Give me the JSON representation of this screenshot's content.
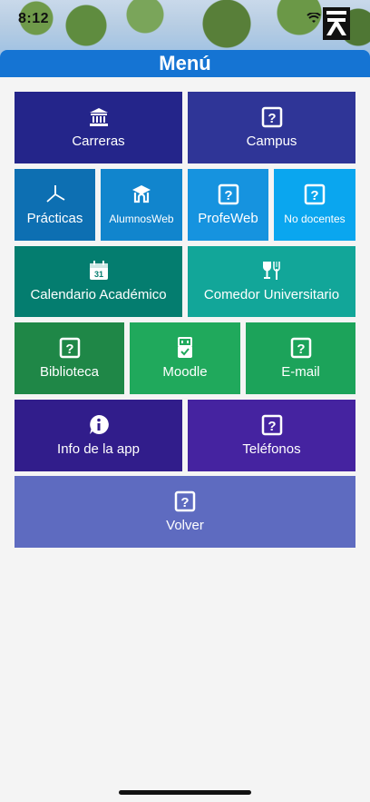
{
  "status": {
    "time": "8:12"
  },
  "header": {
    "title": "Menú"
  },
  "tiles": {
    "carreras": {
      "label": "Carreras",
      "color": "#24258a",
      "icon": "university-icon"
    },
    "campus": {
      "label": "Campus",
      "color": "#2f3597",
      "icon": "question-icon"
    },
    "practicas": {
      "label": "Prácticas",
      "color": "#0d6fb2",
      "icon": "crossed-pointers-icon"
    },
    "alumnosweb": {
      "label": "AlumnosWeb",
      "color": "#1185cd",
      "icon": "graduation-house-icon"
    },
    "profeweb": {
      "label": "ProfeWeb",
      "color": "#1693df",
      "icon": "question-icon"
    },
    "nodocentes": {
      "label": "No docentes",
      "color": "#0aa6ef",
      "icon": "question-icon"
    },
    "calendario": {
      "label": "Calendario Académico",
      "color": "#047d6f",
      "icon": "calendar-icon"
    },
    "comedor": {
      "label": "Comedor Universitario",
      "color": "#12a699",
      "icon": "dining-icon"
    },
    "biblioteca": {
      "label": "Biblioteca",
      "color": "#1f8747",
      "icon": "question-icon"
    },
    "moodle": {
      "label": "Moodle",
      "color": "#20a95c",
      "icon": "usb-icon"
    },
    "email": {
      "label": "E-mail",
      "color": "#1ca35a",
      "icon": "question-icon"
    },
    "info": {
      "label": "Info de la app",
      "color": "#311d8b",
      "icon": "info-icon"
    },
    "telefonos": {
      "label": "Teléfonos",
      "color": "#4523a0",
      "icon": "question-icon"
    },
    "volver": {
      "label": "Volver",
      "color": "#5e6bc0",
      "icon": "question-icon"
    }
  }
}
